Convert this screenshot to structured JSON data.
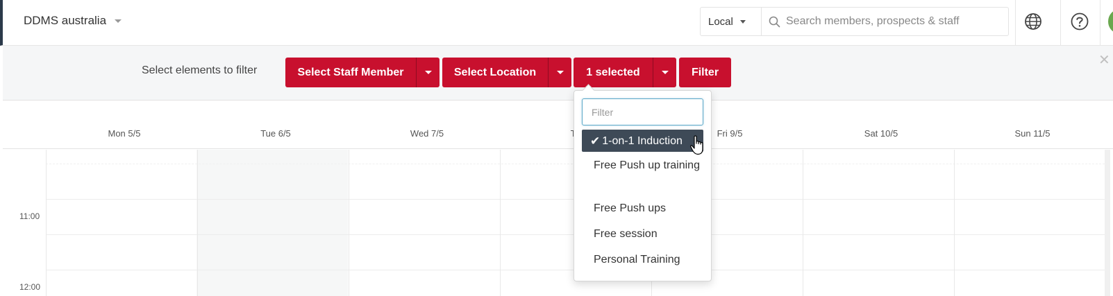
{
  "header": {
    "org_name": "DDMS australia",
    "timezone": "Local",
    "search_placeholder": "Search members, prospects & staff"
  },
  "filter": {
    "label": "Select elements to filter",
    "staff_button": "Select Staff Member",
    "location_button": "Select Location",
    "type_button": "1 selected",
    "filter_button": "Filter"
  },
  "dropdown": {
    "filter_placeholder": "Filter",
    "items": [
      {
        "label": "1-on-1 Induction",
        "selected": true
      },
      {
        "label": "Free Push up training",
        "selected": false
      },
      {
        "label": "Free Push ups",
        "selected": false
      },
      {
        "label": "Free session",
        "selected": false
      },
      {
        "label": "Personal Training",
        "selected": false
      }
    ]
  },
  "calendar": {
    "days": [
      "Mon 5/5",
      "Tue 6/5",
      "Wed 7/5",
      "Thu",
      "Fri 9/5",
      "Sat 10/5",
      "Sun 11/5"
    ],
    "times": [
      "11:00",
      "12:00"
    ]
  },
  "colors": {
    "accent": "#c8102e",
    "selected_item": "#3e4a57",
    "focus_border": "#5aa7c8"
  }
}
